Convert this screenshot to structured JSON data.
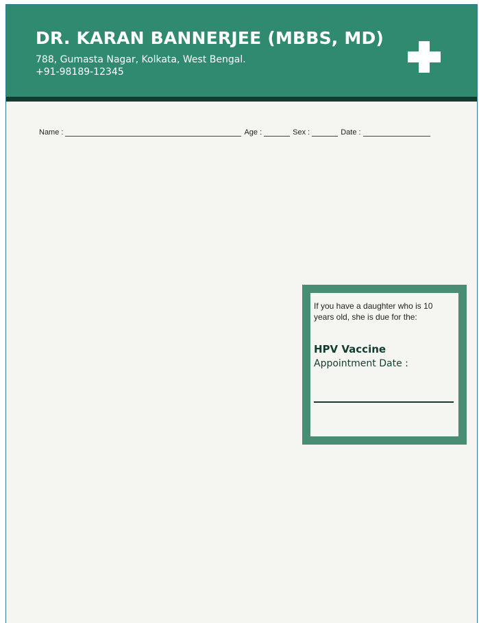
{
  "header": {
    "doctor_name": "DR. KARAN BANNERJEE (MBBS, MD)",
    "address": "788, Gumasta Nagar, Kolkata, West Bengal.",
    "phone": "+91-98189-12345",
    "icon": "medical-cross-icon",
    "bg_color": "#2f8a70",
    "rule_color": "#113d30"
  },
  "form": {
    "name_label": "Name :",
    "age_label": "Age :",
    "sex_label": "Sex :",
    "date_label": "Date :"
  },
  "vaccine_box": {
    "message": "If you have a daughter who is 10 years old, she is due for the:",
    "title": "HPV Vaccine",
    "appointment_label": "Appointment Date :",
    "frame_color": "#4a8d75"
  }
}
